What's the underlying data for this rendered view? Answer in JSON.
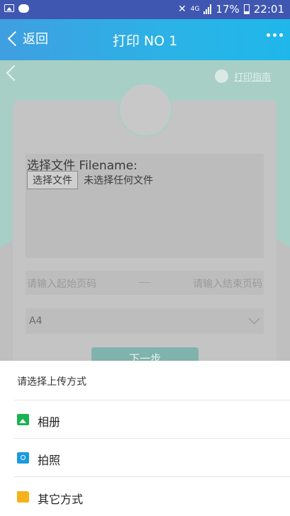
{
  "status_bar": {
    "network": "4G",
    "battery_percent": "17%",
    "time": "22:01"
  },
  "app_bar": {
    "back_label": "返回",
    "title": "打印 NO 1"
  },
  "content": {
    "guide_link": "打印指南",
    "file_label": "选择文件 Filename:",
    "file_button": "选择文件",
    "file_none": "未选择任何文件",
    "start_page_placeholder": "请输入起始页码",
    "end_page_placeholder": "请输入结束页码",
    "paper_size": "A4",
    "next_button": "下一步"
  },
  "sheet": {
    "title": "请选择上传方式",
    "items": [
      {
        "label": "相册",
        "icon": "album-icon",
        "color": "#19b34f"
      },
      {
        "label": "拍照",
        "icon": "camera-icon",
        "color": "#1a9be0"
      },
      {
        "label": "其它方式",
        "icon": "folder-icon",
        "color": "#f6b21b"
      }
    ]
  }
}
